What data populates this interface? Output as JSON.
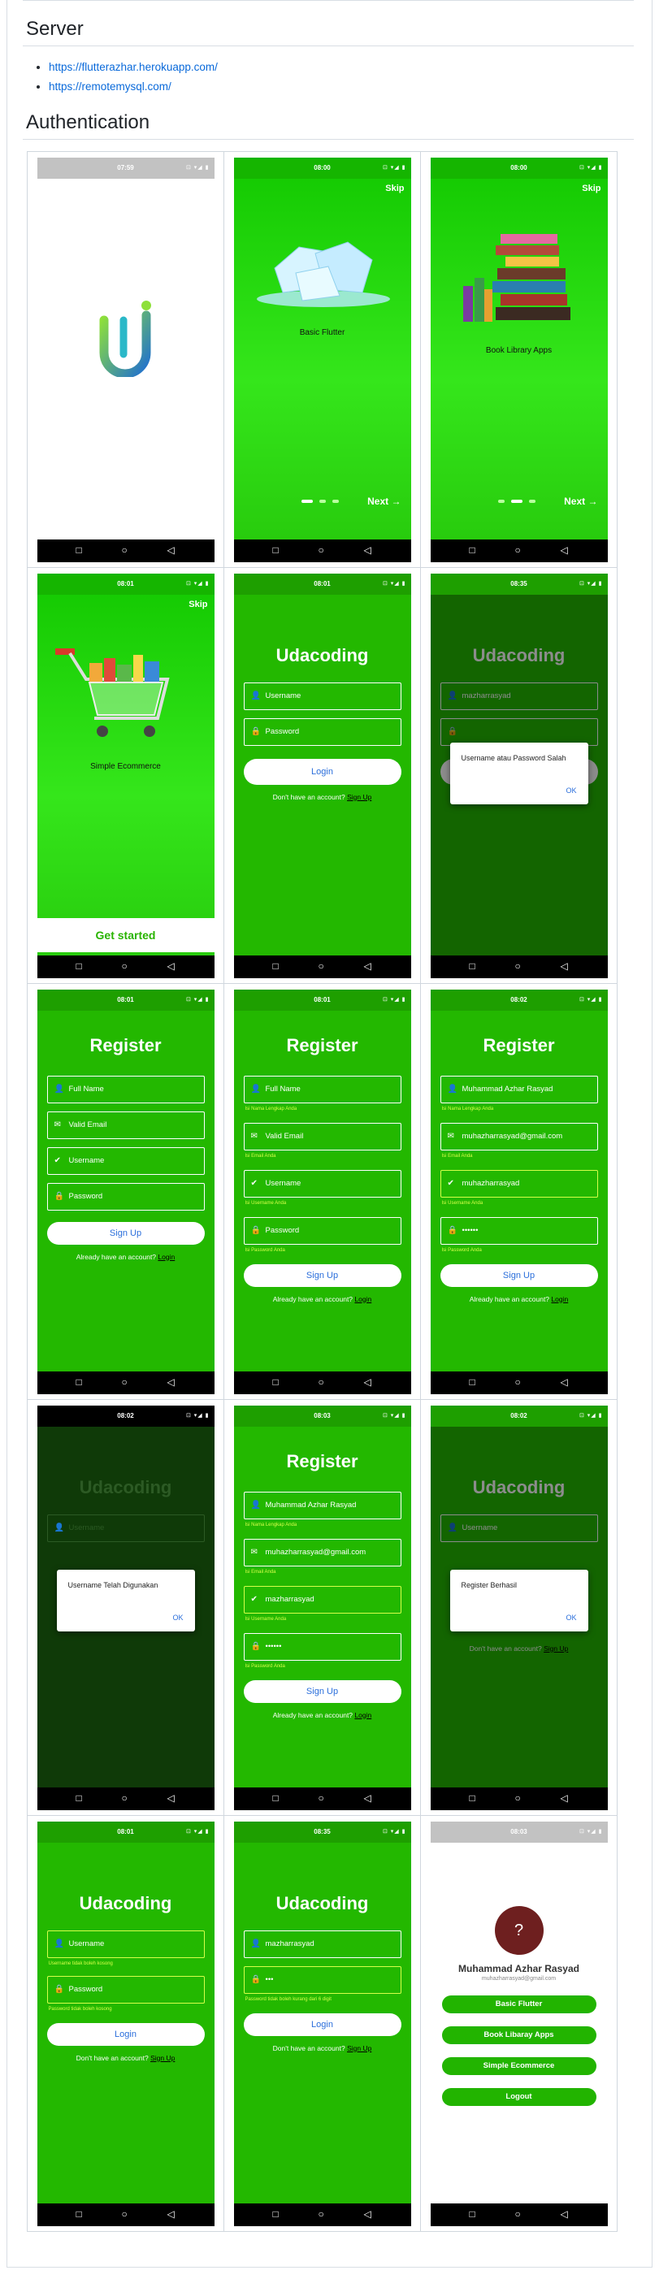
{
  "server": {
    "title": "Server",
    "links": [
      "https://flutterazhar.herokuapp.com/",
      "https://remotemysql.com/"
    ]
  },
  "auth": {
    "title": "Authentication"
  },
  "common": {
    "skip": "Skip",
    "next": "Next",
    "login": "Login",
    "signup": "Sign Up",
    "no_account": "Don't have an account?",
    "have_account": "Already have an account?",
    "app_name": "Udacoding",
    "register": "Register",
    "ok": "OK",
    "username": "Username",
    "password": "Password",
    "full_name": "Full Name",
    "valid_email": "Valid Email",
    "hint_name": "Isi Nama Lengkap Anda",
    "hint_email": "Isi Email Anda",
    "hint_username": "Isi Username Anda",
    "hint_password": "Isi Password Anda",
    "masked": "••••••"
  },
  "status": {
    "t1": "07:59",
    "t2": "08:00",
    "t3": "08:00",
    "t4": "08:01",
    "t5": "08:01",
    "t6": "08:35",
    "t7": "08:01",
    "t8": "08:01",
    "t9": "08:02",
    "t10": "08:02",
    "t11": "08:03",
    "t12": "08:02",
    "t13": "08:01",
    "t14": "08:35",
    "t15": "08:03"
  },
  "screens": {
    "s2": {
      "caption": "Basic Flutter"
    },
    "s3": {
      "caption": "Book Library Apps"
    },
    "s4": {
      "caption": "Simple Ecommerce",
      "cta": "Get started"
    },
    "s6": {
      "dialog": "Username atau Password Salah"
    },
    "s9": {
      "name": "Muhammad Azhar Rasyad",
      "email": "muhazharrasyad@gmail.com",
      "username": "muhazharrasyad"
    },
    "s10": {
      "dialog": "Username Telah Digunakan"
    },
    "s11": {
      "name": "Muhammad Azhar Rasyad",
      "email": "muhazharrasyad@gmail.com",
      "username": "mazharrasyad"
    },
    "s12": {
      "dialog": "Register Berhasil"
    },
    "s13": {
      "err_user": "Username tidak boleh kosong",
      "err_pass": "Password tidak boleh kosong"
    },
    "s14": {
      "username": "mazharrasyad",
      "password": "•••",
      "err_pass": "Password tidak boleh kurang dari 6 digit"
    },
    "s15": {
      "avatar": "?",
      "name": "Muhammad Azhar Rasyad",
      "email": "muhazharrasyad@gmail.com",
      "buttons": [
        "Basic Flutter",
        "Book Libaray Apps",
        "Simple Ecommerce",
        "Logout"
      ]
    }
  },
  "colors": {
    "green": "#23b800",
    "link": "#0969da",
    "button_text": "#2a6edb",
    "hint": "#d6ff4a"
  },
  "icons": {
    "status": "status-icons",
    "nav": [
      "square-icon",
      "circle-icon",
      "triangle-back-icon"
    ],
    "person": "person-icon",
    "lock": "lock-icon",
    "mail": "mail-icon",
    "shield": "shield-check-icon",
    "arrow": "arrow-right-icon"
  }
}
